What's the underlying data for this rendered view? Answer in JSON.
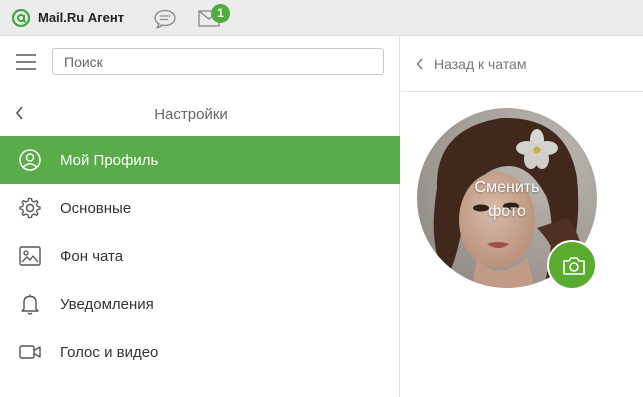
{
  "titlebar": {
    "app_title": "Mail.Ru Агент",
    "mail_badge_count": "1",
    "logo_icon": "at-sign-icon",
    "chat_icon": "chat-bubble-icon",
    "mail_icon": "envelope-icon"
  },
  "search": {
    "placeholder": "Поиск",
    "value": ""
  },
  "settings": {
    "title": "Настройки"
  },
  "menu": {
    "items": [
      {
        "label": "Мой Профиль",
        "icon": "user-profile-icon",
        "active": true
      },
      {
        "label": "Основные",
        "icon": "gear-icon",
        "active": false
      },
      {
        "label": "Фон чата",
        "icon": "image-icon",
        "active": false
      },
      {
        "label": "Уведомления",
        "icon": "bell-icon",
        "active": false
      },
      {
        "label": "Голос и видео",
        "icon": "video-camera-icon",
        "active": false
      }
    ]
  },
  "profile": {
    "back_link": "Назад к чатам",
    "change_photo": "Сменить\nфото",
    "camera_icon": "camera-icon"
  },
  "colors": {
    "accent": "#5aab4a",
    "badge": "#4fad3c",
    "camera_button": "#5aab2f"
  }
}
